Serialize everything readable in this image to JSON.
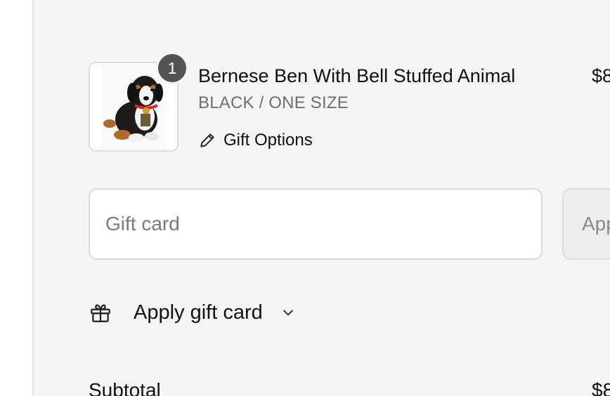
{
  "cart": {
    "item": {
      "quantity": "1",
      "title": "Bernese Ben With Bell Stuffed Animal",
      "variant": "BLACK / ONE SIZE",
      "gift_options_label": "Gift Options",
      "price": "$8"
    }
  },
  "gift_card": {
    "placeholder": "Gift card",
    "apply_button_label": "App",
    "toggle_label": "Apply gift card"
  },
  "totals": {
    "subtotal_label": "Subtotal",
    "subtotal_value": "$8"
  },
  "icons": {
    "edit": "pencil-icon",
    "gift": "gift-icon",
    "toggle": "chevron-down-icon"
  }
}
